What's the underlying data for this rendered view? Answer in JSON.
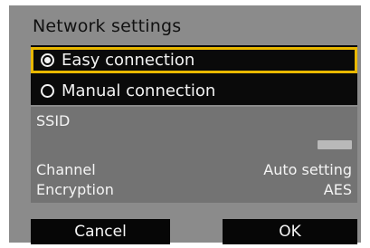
{
  "dialog": {
    "title": "Network settings"
  },
  "options": [
    {
      "label": "Easy connection",
      "selected": true
    },
    {
      "label": "Manual connection",
      "selected": false
    }
  ],
  "info": {
    "ssid_label": "SSID",
    "channel_label": "Channel",
    "channel_value": "Auto setting",
    "encryption_label": "Encryption",
    "encryption_value": "AES"
  },
  "buttons": {
    "cancel": "Cancel",
    "ok": "OK"
  },
  "colors": {
    "selection_border": "#e9b800",
    "panel_bg": "#8b8b8b",
    "option_bg": "#0a0a0a",
    "info_bg": "#737373"
  }
}
